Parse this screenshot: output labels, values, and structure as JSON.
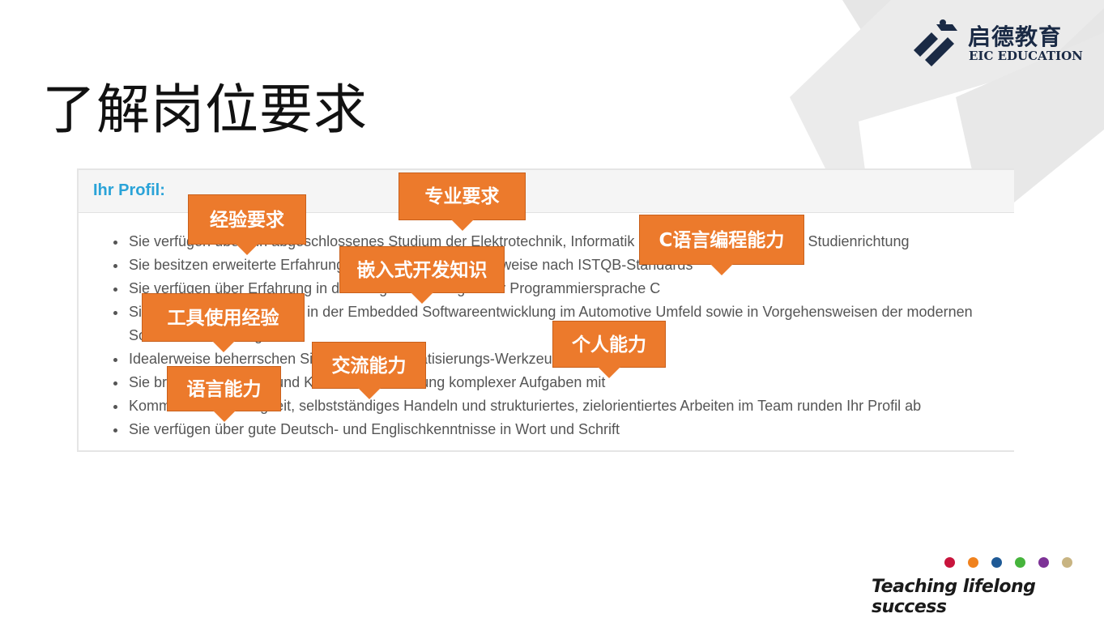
{
  "title": "了解岗位要求",
  "logo": {
    "name_cn": "启德教育",
    "name_en": "EIC EDUCATION"
  },
  "panel": {
    "heading": "Ihr Profil:",
    "items": [
      "Sie verfügen über ein abgeschlossenes Studium der Elektrotechnik, Informatik oder einer vergleichbaren Studienrichtung",
      "Sie besitzen erweiterte Erfahrung im Softwaretest, idealerweise nach ISTQB-Standards",
      "Sie verfügen über Erfahrung in der Programmierung in der Programmiersprache C",
      "Sie haben gute Kenntnisse in der Embedded Softwareentwicklung im Automotive Umfeld sowie in Vorgehensweisen der modernen Softwareentwicklung",
      "Idealerweise beherrschen Sie das Testautomatisierungs-Werkzeug TPT",
      "Sie bringen Kreativität und Kreativität zur Lösung komplexer Aufgaben mit",
      "Kommunikationsfähigkeit, selbstständiges Handeln und strukturiertes, zielorientiertes Arbeiten im Team runden Ihr Profil ab",
      "Sie verfügen über gute Deutsch- und Englischkenntnisse in Wort und Schrift"
    ]
  },
  "tags": {
    "experience": "经验要求",
    "professional": "专业要求",
    "c_programming": "C语言编程能力",
    "embedded": "嵌入式开发知识",
    "tools": "工具使用经验",
    "personal": "个人能力",
    "communication": "交流能力",
    "language": "语言能力"
  },
  "footer": {
    "tagline": "Teaching lifelong success",
    "dot_colors": [
      "#c8143c",
      "#f0821e",
      "#1e5a96",
      "#46b43c",
      "#7d3296",
      "#c8b482"
    ]
  }
}
